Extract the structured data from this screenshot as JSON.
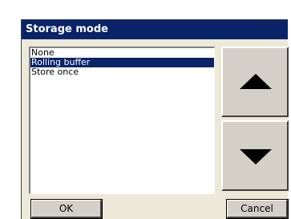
{
  "dialog": {
    "title": "Storage mode",
    "options": [
      {
        "label": "None",
        "selected": false
      },
      {
        "label": "Rolling buffer",
        "selected": true
      },
      {
        "label": "Store once",
        "selected": false
      }
    ],
    "scroll_up_icon": "triangle-up",
    "scroll_down_icon": "triangle-down",
    "ok_label": "OK",
    "cancel_label": "Cancel"
  },
  "colors": {
    "titlebar": "#0a246a",
    "selection": "#0a246a",
    "face": "#d4d0c8"
  }
}
